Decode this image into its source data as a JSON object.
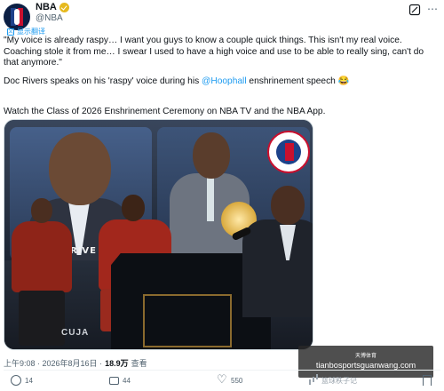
{
  "author": {
    "display_name": "NBA",
    "handle": "@NBA"
  },
  "translate_label": "显示翻译",
  "tweet": {
    "quote": "\"My voice is already raspy… I want you guys to know a couple quick things. This isn't my real voice. Coaching stole it from me… I swear I used to have a high voice and use to be able to really sing, can't do that anymore.\"",
    "line2_prefix": "Doc Rivers speaks on his 'raspy' voice during his ",
    "line2_mention": "@Hoophall",
    "line2_suffix": " enshrinement speech 😂",
    "line3": "Watch the Class of 2026 Enshrinement Ceremony on NBA TV and the NBA App."
  },
  "media": {
    "sign_text": "RIVE",
    "podium_text": "CUJA"
  },
  "meta": {
    "time": "上午9:08 · 2026年8月16日 ·",
    "views_count": "18.9万",
    "views_label": "查看"
  },
  "actions": {
    "replies": "14",
    "retweets": "44",
    "likes": "550",
    "views_overlay": "篮球秩子记"
  },
  "watermark": {
    "top": "天博体育",
    "url": "tianbosportsguanwang.com"
  },
  "colors": {
    "link": "#1d9bf0",
    "text": "#0f1419",
    "muted": "#536471",
    "verified": "#e6b91e"
  },
  "icons": [
    "nba-logo-icon",
    "verified-badge-icon",
    "grok-icon",
    "more-icon",
    "translate-icon",
    "reply-icon",
    "retweet-icon",
    "like-icon",
    "views-icon",
    "bookmark-icon"
  ]
}
